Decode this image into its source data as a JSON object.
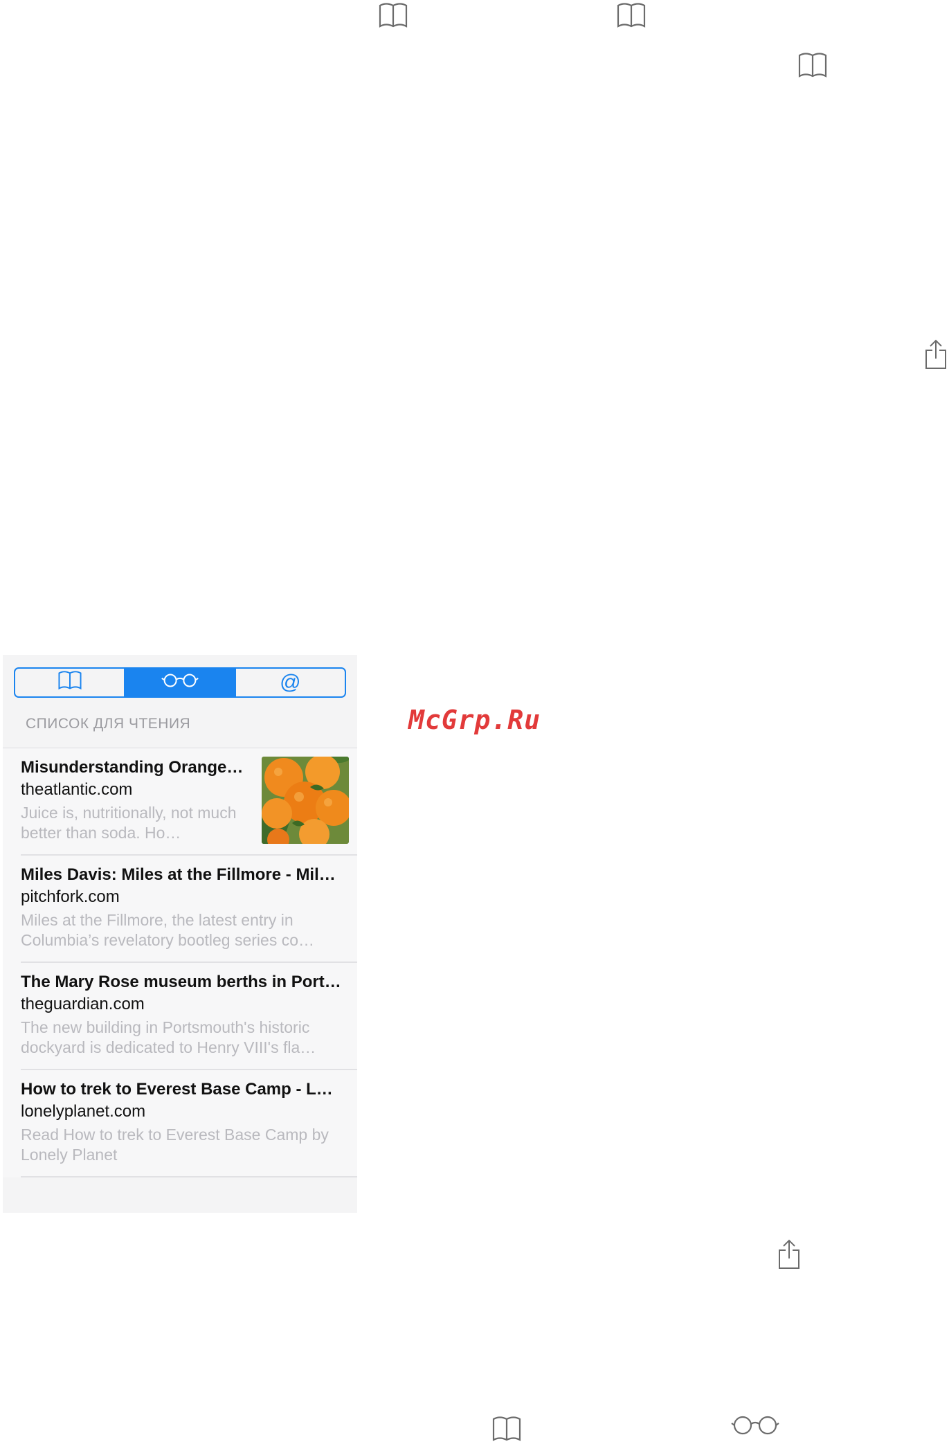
{
  "reading_list": {
    "tabs": [
      {
        "name": "bookmarks",
        "icon": "book-icon",
        "active": false
      },
      {
        "name": "reading-list",
        "icon": "glasses-icon",
        "active": true
      },
      {
        "name": "shared-links",
        "icon": "at-sign-icon",
        "label": "@",
        "active": false
      }
    ],
    "section_title": "СПИСОК ДЛЯ ЧТЕНИЯ",
    "items": [
      {
        "title": "Misunderstanding Orange…",
        "domain": "theatlantic.com",
        "description": "Juice is, nutritionally, not much better than soda. Ho…",
        "has_thumbnail": true
      },
      {
        "title": "Miles Davis: Miles at the Fillmore - Mil…",
        "domain": "pitchfork.com",
        "description": "Miles at the Fillmore, the latest entry in Columbia’s revelatory bootleg series co…",
        "has_thumbnail": false
      },
      {
        "title": "The Mary Rose museum berths in Port…",
        "domain": "theguardian.com",
        "description": "The new building in Portsmouth's historic dockyard is dedicated to Henry VIII's fla…",
        "has_thumbnail": false
      },
      {
        "title": "How to trek to Everest Base Camp - L…",
        "domain": "lonelyplanet.com",
        "description": "Read How to trek to Everest Base Camp by Lonely Planet",
        "has_thumbnail": false
      }
    ]
  },
  "watermark": "McGrp.Ru",
  "colors": {
    "accent": "#1a84ef",
    "icon_gray": "#6b6b6b",
    "watermark_red": "#e23a3a"
  }
}
